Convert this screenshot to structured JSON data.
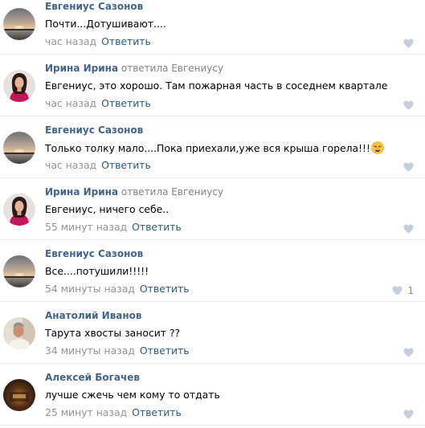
{
  "comments": [
    {
      "author": "Евгениус Сазонов",
      "reply_to": "",
      "text": "Почти...Дотушивают....",
      "time": "час назад",
      "reply_label": "Ответить",
      "likes": "",
      "avatar": "sunset"
    },
    {
      "author": "Ирина Ирина",
      "reply_to": "ответила Евгениусу",
      "text": "Евгениус, это хорошо. Там пожарная часть в соседнем квартале",
      "time": "час назад",
      "reply_label": "Ответить",
      "likes": "",
      "avatar": "woman"
    },
    {
      "author": "Евгениус Сазонов",
      "reply_to": "",
      "text": "Только толку мало....Пока приехали,уже вся крыша горела!!!",
      "emoji": "weary-face-emoji",
      "time": "час назад",
      "reply_label": "Ответить",
      "likes": "",
      "avatar": "sunset"
    },
    {
      "author": "Ирина Ирина",
      "reply_to": "ответила Евгениусу",
      "text": "Евгениус, ничего себе..",
      "time": "55 минут назад",
      "reply_label": "Ответить",
      "likes": "",
      "avatar": "woman"
    },
    {
      "author": "Евгениус Сазонов",
      "reply_to": "",
      "text": "Все....потушили!!!!!",
      "time": "54 минуты назад",
      "reply_label": "Ответить",
      "likes": "1",
      "avatar": "sunset"
    },
    {
      "author": "Анатолий Иванов",
      "reply_to": "",
      "text": "Тарута хвосты заносит ??",
      "time": "34 минуты назад",
      "reply_label": "Ответить",
      "likes": "",
      "avatar": "man"
    },
    {
      "author": "Алексей Богачев",
      "reply_to": "",
      "text": "лучше сжечь чем кому то отдать",
      "time": "25 минут назад",
      "reply_label": "Ответить",
      "likes": "",
      "avatar": "dark"
    }
  ],
  "colors": {
    "author": "#42648b",
    "link": "#2a5885",
    "meta": "#939393",
    "like_heart": "#c3cfdc",
    "divider": "#e7e8ec"
  }
}
